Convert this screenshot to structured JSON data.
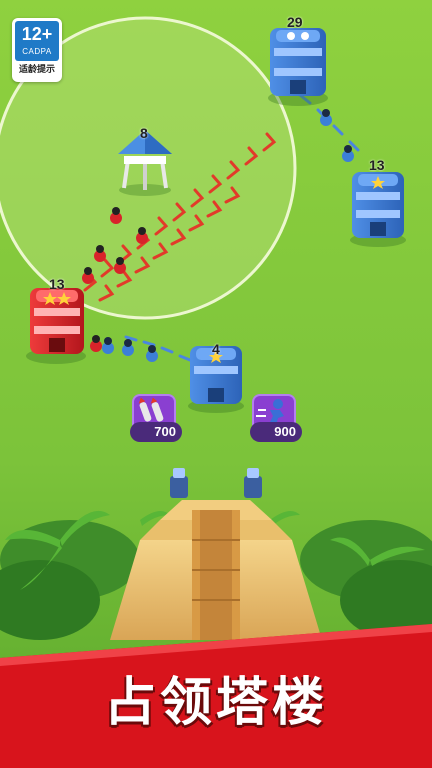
{
  "age_rating": {
    "age": "12+",
    "org": "CADPA",
    "tip": "适龄提示"
  },
  "towers": {
    "top_blue": "29",
    "right_blue": "13",
    "watchtower": "8",
    "red": "13",
    "center_blue": "4"
  },
  "powerups": [
    {
      "name": "missile",
      "cost": "700"
    },
    {
      "name": "speed",
      "cost": "900"
    }
  ],
  "banner": {
    "title": "占领塔楼"
  },
  "colors": {
    "grass": "#7cc33a",
    "banner_red": "#d8141c",
    "blue_team": "#3c7fd8",
    "red_team": "#d8232a",
    "power_card": "#8a3fd1",
    "coin": "#f2b21c"
  }
}
